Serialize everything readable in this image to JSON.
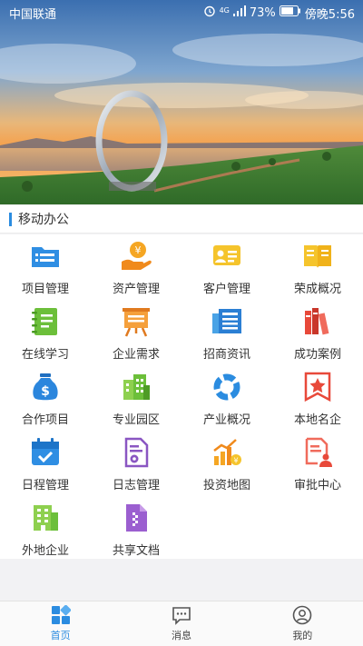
{
  "status_bar": {
    "carrier": "中国联通",
    "network": "4G",
    "battery": "73%",
    "time": "傍晚5:56"
  },
  "section": {
    "title": "移动办公"
  },
  "grid": [
    {
      "label": "项目管理",
      "icon": "folder-icon"
    },
    {
      "label": "资产管理",
      "icon": "money-hand-icon"
    },
    {
      "label": "客户管理",
      "icon": "contact-card-icon"
    },
    {
      "label": "荣成概况",
      "icon": "book-icon"
    },
    {
      "label": "在线学习",
      "icon": "notebook-icon"
    },
    {
      "label": "企业需求",
      "icon": "presentation-board-icon"
    },
    {
      "label": "招商资讯",
      "icon": "newspaper-icon"
    },
    {
      "label": "成功案例",
      "icon": "books-icon"
    },
    {
      "label": "合作项目",
      "icon": "money-bag-icon"
    },
    {
      "label": "专业园区",
      "icon": "buildings-icon"
    },
    {
      "label": "产业概况",
      "icon": "pie-chart-icon"
    },
    {
      "label": "本地名企",
      "icon": "star-badge-icon"
    },
    {
      "label": "日程管理",
      "icon": "calendar-icon"
    },
    {
      "label": "日志管理",
      "icon": "log-settings-icon"
    },
    {
      "label": "投资地图",
      "icon": "growth-chart-icon"
    },
    {
      "label": "审批中心",
      "icon": "approval-stamp-icon"
    },
    {
      "label": "外地企业",
      "icon": "office-building-icon"
    },
    {
      "label": "共享文档",
      "icon": "shared-document-icon"
    }
  ],
  "tabs": [
    {
      "label": "首页",
      "icon": "home-grid-icon",
      "active": true
    },
    {
      "label": "消息",
      "icon": "chat-bubble-icon",
      "active": false
    },
    {
      "label": "我的",
      "icon": "user-icon",
      "active": false
    }
  ],
  "colors": {
    "accent": "#2b8ce0",
    "background": "#f2f2f4"
  }
}
